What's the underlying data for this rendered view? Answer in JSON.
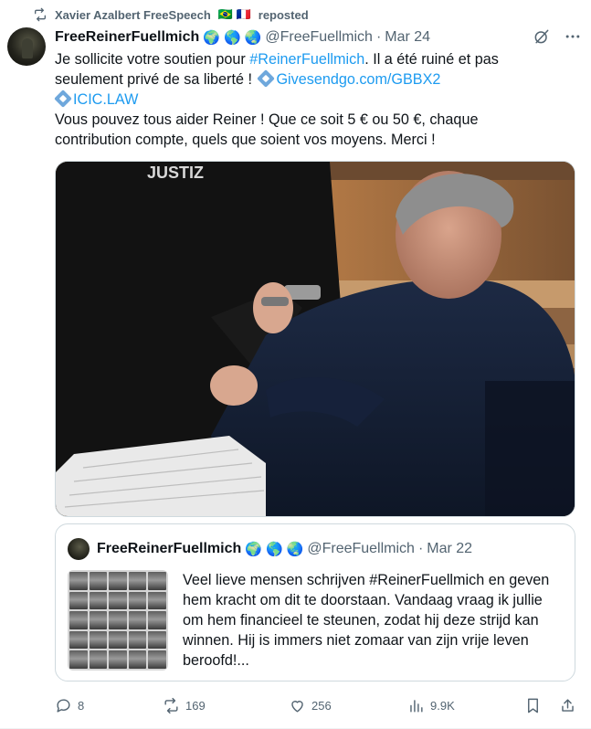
{
  "repost": {
    "reposter_name": "Xavier Azalbert FreeSpeech",
    "flags": "🇧🇷 🇫🇷",
    "label": "reposted"
  },
  "tweet": {
    "author_name": "FreeReinerFuellmich",
    "author_emojis": [
      "🌍",
      "🌎",
      "🌏"
    ],
    "handle": "@FreeFuellmich",
    "separator": "·",
    "date": "Mar 24",
    "text": {
      "l1_prefix": "Je sollicite votre soutien pour ",
      "l1_hashtag": "#ReinerFuellmich",
      "l1_suffix": ". Il a été ruiné et pas",
      "l2_prefix": "seulement privé de sa liberté ! ",
      "l2_link": "Givesendgo.com/GBBX2",
      "l3_link": "ICIC.LAW",
      "l4": "Vous pouvez tous aider Reiner ! Que ce soit 5 € ou 50 €, chaque",
      "l5": "contribution compte, quels que soient vos moyens. Merci !"
    },
    "photo": {
      "vest_text": "JUSTIZ"
    }
  },
  "quote": {
    "author_name": "FreeReinerFuellmich",
    "author_emojis": [
      "🌍",
      "🌎",
      "🌏"
    ],
    "handle": "@FreeFuellmich",
    "separator": "·",
    "date": "Mar 22",
    "lines": [
      "Veel lieve mensen schrijven #ReinerFuellmich en geven",
      "hem kracht om dit te doorstaan. Vandaag vraag ik jullie",
      "om hem financieel te steunen, zodat hij deze strijd kan",
      "winnen. Hij is immers niet zomaar van zijn vrije leven",
      "beroofd!..."
    ]
  },
  "actions": {
    "replies": "8",
    "reposts": "169",
    "likes": "256",
    "views": "9.9K"
  },
  "colors": {
    "accent": "#1d9bf0",
    "repost_green": "#00ba7c",
    "muted": "#536471",
    "border": "#cfd9de"
  }
}
